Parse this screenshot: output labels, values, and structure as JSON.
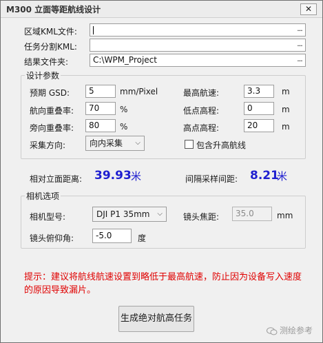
{
  "window": {
    "title": "M300 立面等距航线设计",
    "close_glyph": "✕"
  },
  "files": {
    "region_kml_label": "区域KML文件:",
    "region_kml_value": "",
    "task_split_label": "任务分割KML:",
    "task_split_value": "",
    "result_folder_label": "结果文件夹:",
    "result_folder_value": "C:\\WPM_Project",
    "browse_label": "..."
  },
  "design": {
    "group_title": "设计参数",
    "gsd_label": "预期 GSD:",
    "gsd_value": "5",
    "gsd_unit": "mm/Pixel",
    "forward_overlap_label": "航向重叠率:",
    "forward_overlap_value": "70",
    "side_overlap_label": "旁向重叠率:",
    "side_overlap_value": "80",
    "percent_unit": "%",
    "direction_label": "采集方向:",
    "direction_value": "向内采集",
    "max_speed_label": "最高航速:",
    "max_speed_value": "3.3",
    "min_alt_label": "低点高程:",
    "min_alt_value": "0",
    "max_alt_label": "高点高程:",
    "max_alt_value": "20",
    "m_unit": "m",
    "include_climb_label": "包含升高航线",
    "include_climb_checked": false
  },
  "results": {
    "facade_distance_label": "相对立面距离:",
    "facade_distance_value": "39.93",
    "interval_label": "间隔采样间距:",
    "interval_value": "8.21",
    "unit_cn": "米"
  },
  "camera": {
    "group_title": "相机选项",
    "model_label": "相机型号:",
    "model_value": "DJI P1 35mm",
    "focal_label": "镜头焦距:",
    "focal_value": "35.0",
    "focal_unit": "mm",
    "pitch_label": "镜头俯仰角:",
    "pitch_value": "-5.0",
    "pitch_unit": "度"
  },
  "hint": "提示：建议将航线航速设置到略低于最高航速，防止因为设备写入速度的原因导致漏片。",
  "generate_button": "生成绝对航高任务",
  "watermark": "测绘参考",
  "icons": {
    "browse": "ellipsis-icon",
    "dropdown": "chevron-down-icon",
    "watermark": "wechat-icon"
  }
}
